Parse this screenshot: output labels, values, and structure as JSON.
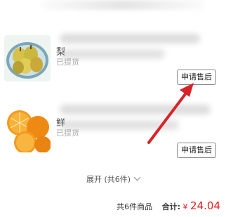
{
  "items": [
    {
      "name_visible": "梨",
      "status": "已提货",
      "thumb_icon": "pear-product-image",
      "aftersale_label": "申请售后"
    },
    {
      "name_visible": "鲜",
      "status": "已提货",
      "thumb_icon": "orange-product-image",
      "aftersale_label": "申请售后"
    }
  ],
  "expand": {
    "label": "展开 (共6件)"
  },
  "summary": {
    "count_text": "共6件商品",
    "total_label": "合计:",
    "currency": "¥",
    "amount": "24.04"
  },
  "colors": {
    "price_red": "#e02020",
    "arrow_red": "#d8232a"
  }
}
